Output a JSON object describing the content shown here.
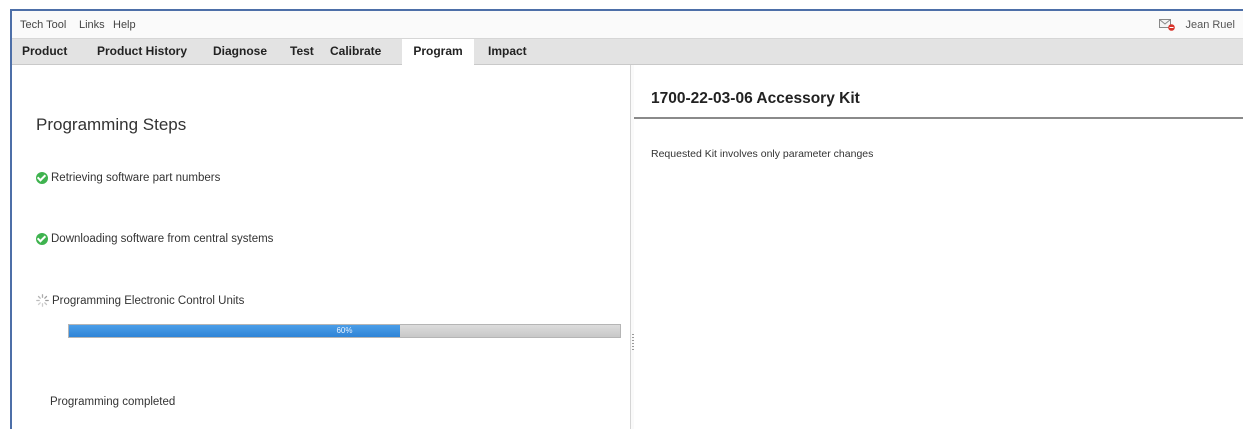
{
  "menubar": {
    "items": [
      "Tech Tool",
      "Links",
      "Help"
    ],
    "user_name": "Jean Ruel"
  },
  "tabs": [
    {
      "label": "Product"
    },
    {
      "label": "Product History"
    },
    {
      "label": "Diagnose"
    },
    {
      "label": "Test"
    },
    {
      "label": "Calibrate"
    },
    {
      "label": "Program",
      "active": true
    },
    {
      "label": "Impact"
    }
  ],
  "programming": {
    "title": "Programming Steps",
    "steps": [
      {
        "label": "Retrieving software part numbers",
        "status": "done"
      },
      {
        "label": "Downloading software from central systems",
        "status": "done"
      },
      {
        "label": "Programming Electronic Control Units",
        "status": "in-progress"
      }
    ],
    "progress": {
      "value": 60,
      "label": "60%"
    },
    "completed_label": "Programming completed"
  },
  "kit": {
    "title": "1700-22-03-06 Accessory Kit",
    "message": "Requested Kit involves only parameter changes"
  },
  "colors": {
    "accent_blue": "#3a8fe0",
    "check_green": "#3fb34f",
    "window_border": "#4d6fa8"
  }
}
